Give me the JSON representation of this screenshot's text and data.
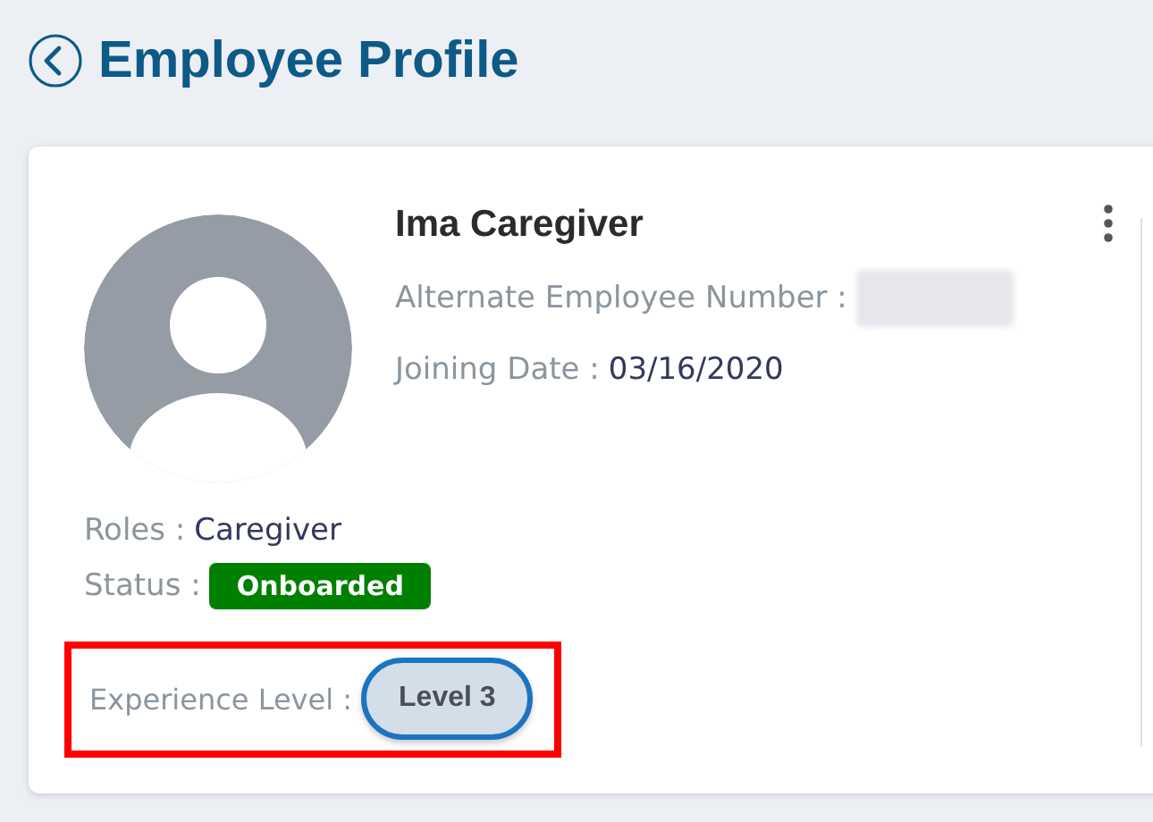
{
  "header": {
    "title": "Employee Profile"
  },
  "profile": {
    "name": "Ima Caregiver",
    "alternate_employee_number": {
      "label": "Alternate Employee Number :",
      "redacted": true
    },
    "joining_date": {
      "label": "Joining Date :",
      "value": "03/16/2020"
    },
    "roles": {
      "label": "Roles :",
      "value": "Caregiver"
    },
    "status": {
      "label": "Status :",
      "value": "Onboarded",
      "color": "#008000"
    },
    "experience_level": {
      "label": "Experience Level :",
      "value": "Level 3",
      "highlighted": true
    }
  }
}
